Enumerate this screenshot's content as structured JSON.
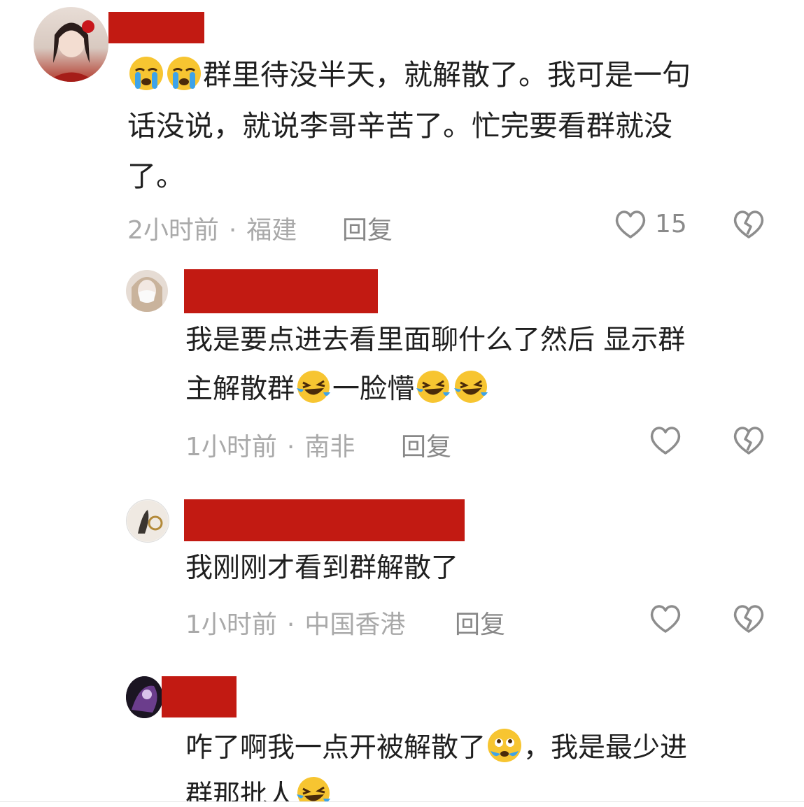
{
  "colors": {
    "redaction": "#c21a12",
    "meta": "#a9a9a9",
    "reply_btn": "#888888",
    "icon": "#8d8d8d"
  },
  "comments": [
    {
      "avatar": "woman-with-red-flower-avatar",
      "text_parts": [
        "群里待没半天，就解散了。我可是一句",
        "话没说，就说李哥辛苦了。忙完要看群就没",
        "了。"
      ],
      "time": "2小时前",
      "dot": "·",
      "location": "福建",
      "reply_label": "回复",
      "likes": "15"
    },
    {
      "avatar": "masked-person-avatar",
      "text_parts": [
        "我是要点进去看里面聊什么了然后  显示群",
        "主解散群",
        "一脸懵"
      ],
      "time": "1小时前",
      "dot": "·",
      "location": "南非",
      "reply_label": "回复"
    },
    {
      "avatar": "dark-circle-logo-avatar",
      "text_parts": [
        "我刚刚才看到群解散了"
      ],
      "time": "1小时前",
      "dot": "·",
      "location": "中国香港",
      "reply_label": "回复"
    },
    {
      "avatar": "purple-anime-avatar",
      "text_parts": [
        "咋了啊我一点开被解散了",
        "，我是最少进",
        "群那批人"
      ]
    }
  ],
  "icons": {
    "like": "heart-outline-icon",
    "dislike": "broken-heart-icon",
    "cry": "crying-face-emoji",
    "laugh": "laughing-tears-emoji",
    "teary": "teary-eyes-emoji"
  }
}
